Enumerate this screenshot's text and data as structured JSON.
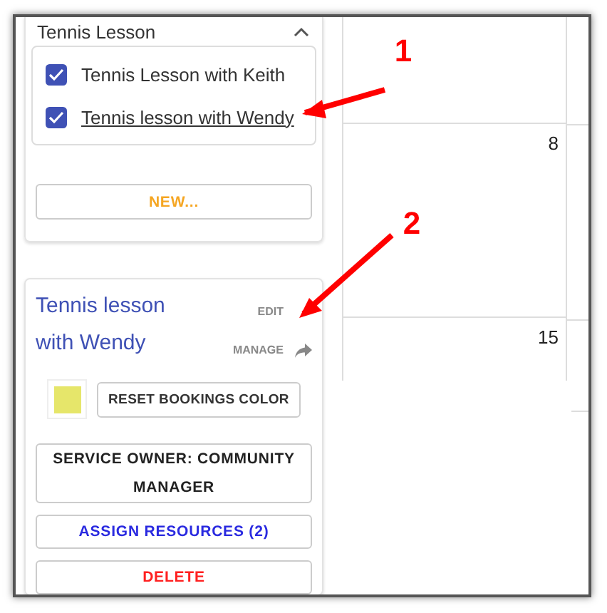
{
  "group": {
    "title": "Tennis Lesson",
    "expanded": true,
    "items": [
      {
        "label": "Tennis Lesson with Keith",
        "checked": true,
        "hovered": false
      },
      {
        "label": "Tennis lesson with Wendy",
        "checked": true,
        "hovered": true
      }
    ],
    "new_button": "NEW..."
  },
  "detail": {
    "title": "Tennis lesson with Wendy",
    "edit": "EDIT",
    "manage": "MANAGE",
    "color": "#e6e66a",
    "reset_button": "RESET BOOKINGS COLOR",
    "buttons": [
      {
        "label": "SERVICE OWNER: COMMUNITY MANAGER",
        "kind": "default"
      },
      {
        "label": "ASSIGN RESOURCES (2)",
        "kind": "primary"
      },
      {
        "label": "DELETE",
        "kind": "danger"
      }
    ]
  },
  "calendar": {
    "days": [
      "8",
      "15"
    ]
  },
  "annotations": [
    {
      "label": "1"
    },
    {
      "label": "2"
    }
  ]
}
